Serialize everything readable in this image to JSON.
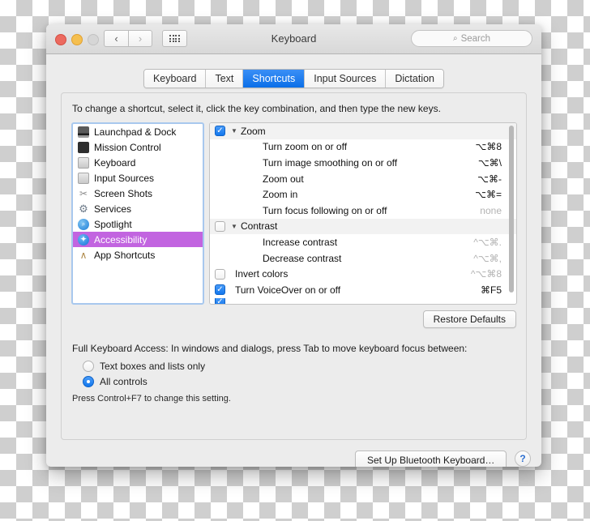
{
  "window": {
    "title": "Keyboard",
    "traffic_lights": [
      "close",
      "minimize",
      "zoom"
    ],
    "nav_back": "‹",
    "nav_forward": "›",
    "search_placeholder": "Search",
    "search_icon": "⌕"
  },
  "tabs": [
    {
      "label": "Keyboard",
      "active": false
    },
    {
      "label": "Text",
      "active": false
    },
    {
      "label": "Shortcuts",
      "active": true
    },
    {
      "label": "Input Sources",
      "active": false
    },
    {
      "label": "Dictation",
      "active": false
    }
  ],
  "instructions": "To change a shortcut, select it, click the key combination, and then type the new keys.",
  "sidebar": {
    "items": [
      {
        "label": "Launchpad & Dock",
        "icon": "laptop-icon",
        "selected": false
      },
      {
        "label": "Mission Control",
        "icon": "mission-control-icon",
        "selected": false
      },
      {
        "label": "Keyboard",
        "icon": "keyboard-icon",
        "selected": false
      },
      {
        "label": "Input Sources",
        "icon": "keyboard-icon",
        "selected": false
      },
      {
        "label": "Screen Shots",
        "icon": "screenshot-icon",
        "selected": false
      },
      {
        "label": "Services",
        "icon": "gear-icon",
        "selected": false
      },
      {
        "label": "Spotlight",
        "icon": "spotlight-icon",
        "selected": false
      },
      {
        "label": "Accessibility",
        "icon": "accessibility-icon",
        "selected": true
      },
      {
        "label": "App Shortcuts",
        "icon": "app-shortcuts-icon",
        "selected": false
      }
    ]
  },
  "shortcuts": {
    "rows": [
      {
        "label": "Zoom",
        "key": "",
        "checkbox": "checked",
        "group": true,
        "indent": false,
        "dim": false
      },
      {
        "label": "Turn zoom on or off",
        "key": "⌥⌘8",
        "checkbox": "none",
        "group": false,
        "indent": true,
        "dim": false
      },
      {
        "label": "Turn image smoothing on or off",
        "key": "⌥⌘\\",
        "checkbox": "none",
        "group": false,
        "indent": true,
        "dim": false
      },
      {
        "label": "Zoom out",
        "key": "⌥⌘-",
        "checkbox": "none",
        "group": false,
        "indent": true,
        "dim": false
      },
      {
        "label": "Zoom in",
        "key": "⌥⌘=",
        "checkbox": "none",
        "group": false,
        "indent": true,
        "dim": false
      },
      {
        "label": "Turn focus following on or off",
        "key": "none",
        "checkbox": "none",
        "group": false,
        "indent": true,
        "dim": true
      },
      {
        "label": "Contrast",
        "key": "",
        "checkbox": "unchecked",
        "group": true,
        "indent": false,
        "dim": false
      },
      {
        "label": "Increase contrast",
        "key": "^⌥⌘.",
        "checkbox": "none",
        "group": false,
        "indent": true,
        "dim": true
      },
      {
        "label": "Decrease contrast",
        "key": "^⌥⌘,",
        "checkbox": "none",
        "group": false,
        "indent": true,
        "dim": true
      },
      {
        "label": "Invert colors",
        "key": "^⌥⌘8",
        "checkbox": "unchecked",
        "group": false,
        "indent": false,
        "dim": true
      },
      {
        "label": "Turn VoiceOver on or off",
        "key": "⌘F5",
        "checkbox": "checked",
        "group": false,
        "indent": false,
        "dim": false
      }
    ],
    "disclosure_open": "▼"
  },
  "restore_defaults_label": "Restore Defaults",
  "full_keyboard_access": {
    "title": "Full Keyboard Access: In windows and dialogs, press Tab to move keyboard focus between:",
    "options": [
      {
        "label": "Text boxes and lists only",
        "selected": false
      },
      {
        "label": "All controls",
        "selected": true
      }
    ],
    "hint": "Press Control+F7 to change this setting."
  },
  "footer": {
    "bluetooth_label": "Set Up Bluetooth Keyboard…",
    "help_label": "?"
  },
  "colors": {
    "accent_blue": "#0b6fe8",
    "selection_purple": "#c264e0",
    "window_bg": "#ececec"
  }
}
